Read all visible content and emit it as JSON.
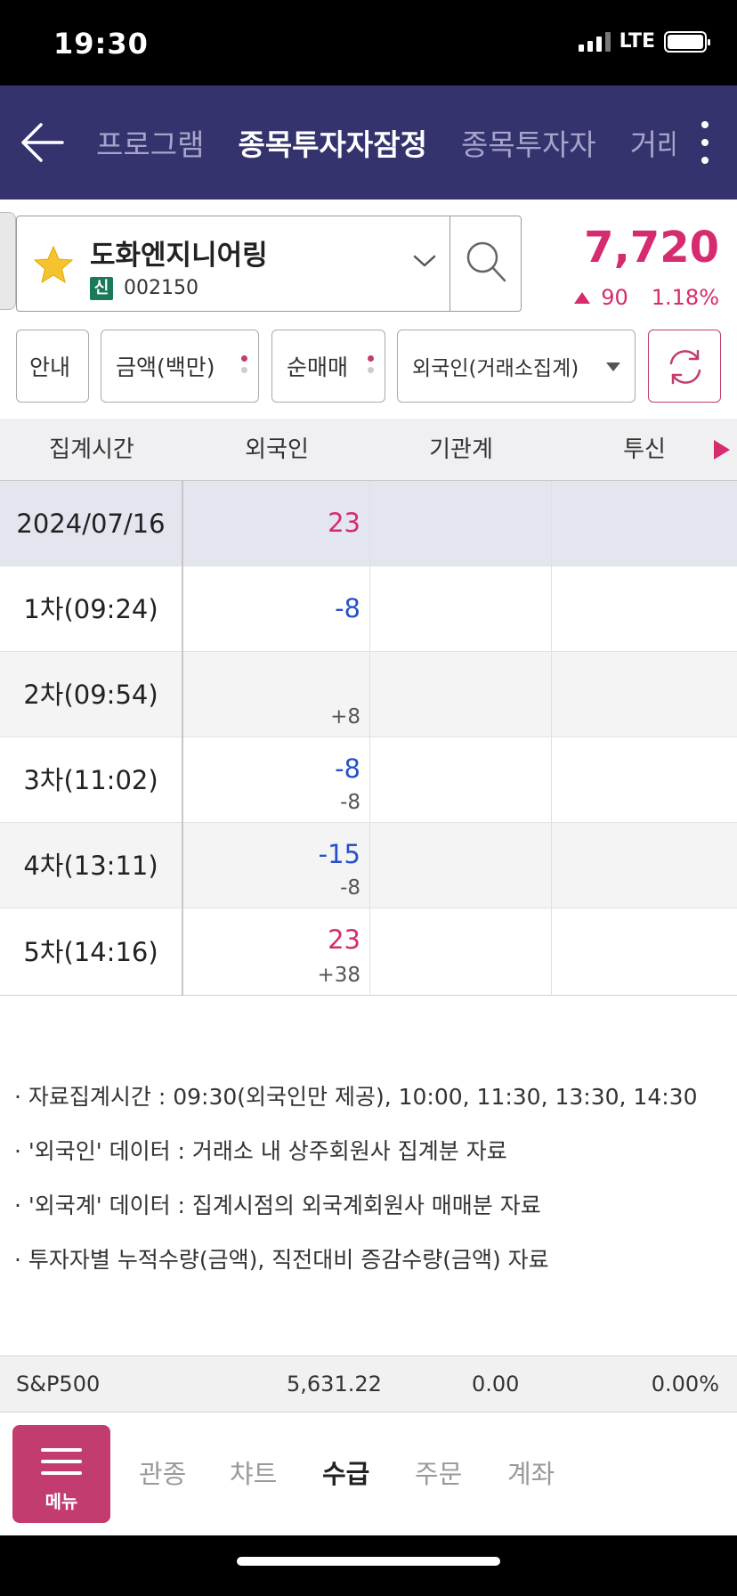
{
  "status": {
    "time": "19:30",
    "network": "LTE"
  },
  "nav": {
    "tabs": [
      {
        "label": "프로그램"
      },
      {
        "label": "종목투자자잠정"
      },
      {
        "label": "종목투자자"
      },
      {
        "label": "거래"
      }
    ],
    "active_tab": 1
  },
  "stock": {
    "name": "도화엔지니어링",
    "badge": "신",
    "code": "002150",
    "price": "7,720",
    "change": "90",
    "change_pct": "1.18%",
    "price_color": "#d62b6e"
  },
  "filters": {
    "info_label": "안내",
    "amount_label": "금액(백만)",
    "net_label": "순매매",
    "investor_select": "외국인(거래소집계)"
  },
  "table": {
    "headers": [
      "집계시간",
      "외국인",
      "기관계",
      "투신"
    ],
    "rows": [
      {
        "time": "2024/07/16",
        "foreign": "23",
        "foreign_sign": "pos",
        "delta": ""
      },
      {
        "time": "1차(09:24)",
        "foreign": "-8",
        "foreign_sign": "neg",
        "delta": ""
      },
      {
        "time": "2차(09:54)",
        "foreign": "",
        "foreign_sign": "",
        "delta": "+8"
      },
      {
        "time": "3차(11:02)",
        "foreign": "-8",
        "foreign_sign": "neg",
        "delta": "-8"
      },
      {
        "time": "4차(13:11)",
        "foreign": "-15",
        "foreign_sign": "neg",
        "delta": "-8"
      },
      {
        "time": "5차(14:16)",
        "foreign": "23",
        "foreign_sign": "pos",
        "delta": "+38"
      }
    ]
  },
  "notes": [
    "· 자료집계시간 : 09:30(외국인만 제공), 10:00, 11:30, 13:30, 14:30",
    "· '외국인' 데이터 : 거래소 내 상주회원사 집계분 자료",
    "· '외국계' 데이터 : 집계시점의 외국계회원사 매매분 자료",
    "· 투자자별 누적수량(금액), 직전대비 증감수량(금액) 자료"
  ],
  "index_bar": {
    "name": "S&P500",
    "value": "5,631.22",
    "change": "0.00",
    "change_pct": "0.00%"
  },
  "bottom_nav": {
    "menu_label": "메뉴",
    "items": [
      {
        "label": "관종"
      },
      {
        "label": "챠트"
      },
      {
        "label": "수급"
      },
      {
        "label": "주문"
      },
      {
        "label": "계좌"
      }
    ],
    "active_item": 2
  },
  "colors": {
    "nav_bg": "#35336e",
    "accent": "#c23c70",
    "up": "#d62b6e",
    "down": "#2651c9"
  }
}
